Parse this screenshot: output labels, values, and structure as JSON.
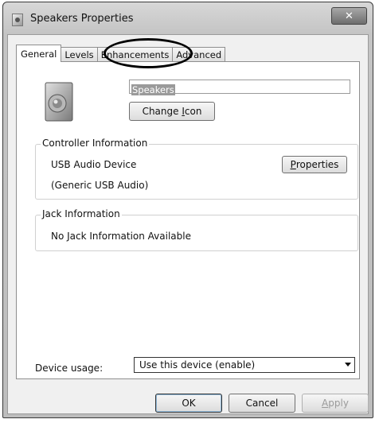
{
  "window": {
    "title": "Speakers Properties",
    "close_glyph": "✕"
  },
  "tabs": [
    {
      "label": "General",
      "active": true
    },
    {
      "label": "Levels",
      "active": false
    },
    {
      "label": "Enhancements",
      "active": false
    },
    {
      "label": "Advanced",
      "active": false
    }
  ],
  "general": {
    "device_name": "Speakers",
    "change_icon_prefix": "Change ",
    "change_icon_accel": "I",
    "change_icon_suffix": "con",
    "controller": {
      "group_label": "Controller Information",
      "device": "USB Audio Device",
      "driver": "(Generic USB Audio)",
      "properties_accel": "P",
      "properties_suffix": "roperties"
    },
    "jack": {
      "group_label": "Jack Information",
      "status": "No Jack Information Available"
    },
    "device_usage": {
      "label": "Device usage:",
      "selected": "Use this device (enable)"
    }
  },
  "footer": {
    "ok": "OK",
    "cancel": "Cancel",
    "apply_accel": "A",
    "apply_suffix": "pply"
  }
}
